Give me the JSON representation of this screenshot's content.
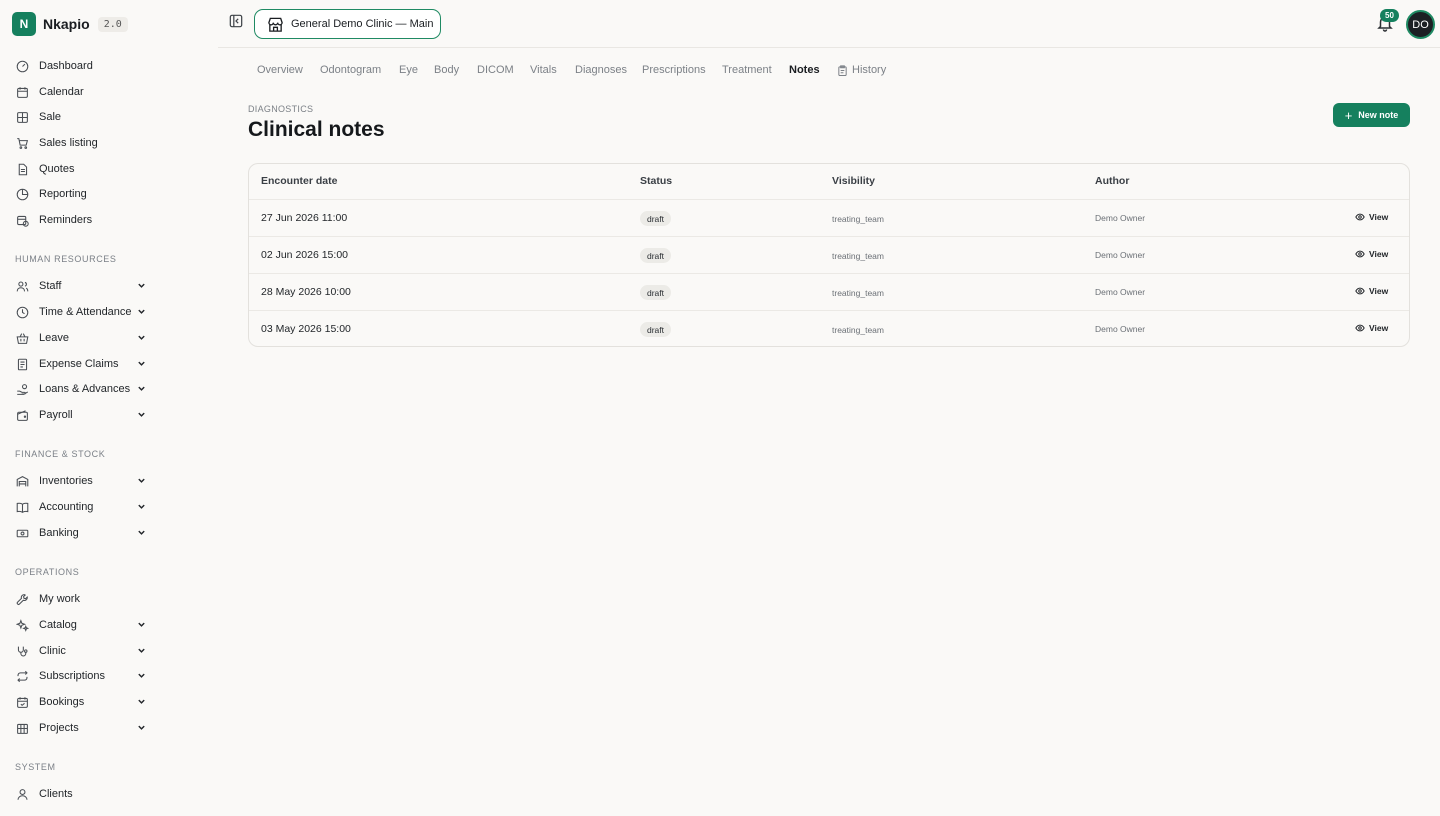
{
  "app": {
    "logo_letter": "N",
    "name": "Nkapio",
    "version": "2.0"
  },
  "sidebar": {
    "main_items": [
      {
        "label": "Dashboard",
        "icon": "gauge-icon"
      },
      {
        "label": "Calendar",
        "icon": "calendar-icon"
      },
      {
        "label": "Sale",
        "icon": "grid-icon"
      },
      {
        "label": "Sales listing",
        "icon": "cart-icon"
      },
      {
        "label": "Quotes",
        "icon": "document-icon"
      },
      {
        "label": "Reporting",
        "icon": "pie-chart-icon"
      },
      {
        "label": "Reminders",
        "icon": "calendar-clock-icon"
      }
    ],
    "sections": [
      {
        "label": "HUMAN RESOURCES",
        "items": [
          {
            "label": "Staff",
            "icon": "users-icon"
          },
          {
            "label": "Time & Attendance",
            "icon": "clock-icon"
          },
          {
            "label": "Leave",
            "icon": "basket-icon"
          },
          {
            "label": "Expense Claims",
            "icon": "receipt-icon"
          },
          {
            "label": "Loans & Advances",
            "icon": "hand-coins-icon"
          },
          {
            "label": "Payroll",
            "icon": "wallet-icon"
          }
        ]
      },
      {
        "label": "FINANCE & STOCK",
        "items": [
          {
            "label": "Inventories",
            "icon": "warehouse-icon"
          },
          {
            "label": "Accounting",
            "icon": "book-icon"
          },
          {
            "label": "Banking",
            "icon": "banknote-icon"
          }
        ]
      },
      {
        "label": "OPERATIONS",
        "items": [
          {
            "label": "My work",
            "icon": "wrench-icon"
          },
          {
            "label": "Catalog",
            "icon": "sparkles-icon"
          },
          {
            "label": "Clinic",
            "icon": "stethoscope-icon"
          },
          {
            "label": "Subscriptions",
            "icon": "repeat-icon"
          },
          {
            "label": "Bookings",
            "icon": "calendar-check-icon"
          },
          {
            "label": "Projects",
            "icon": "building-icon"
          }
        ]
      },
      {
        "label": "SYSTEM",
        "items": [
          {
            "label": "Clients",
            "icon": "user-icon"
          }
        ]
      }
    ]
  },
  "topbar": {
    "clinic_name": "General Demo Clinic — Main",
    "notifications": "50",
    "avatar_initials": "DO"
  },
  "tabs": [
    "Overview",
    "Odontogram",
    "Eye",
    "Body",
    "DICOM",
    "Vitals",
    "Diagnoses",
    "Prescriptions",
    "Treatment",
    "Notes",
    "History"
  ],
  "active_tab": "Notes",
  "page": {
    "eyebrow": "DIAGNOSTICS",
    "title": "Clinical notes",
    "new_button": "New note"
  },
  "table": {
    "headers": [
      "Encounter date",
      "Status",
      "Visibility",
      "Author"
    ],
    "rows": [
      {
        "date": "27 Jun 2026 11:00",
        "status": "draft",
        "visibility": "treating_team",
        "author": "Demo Owner",
        "action": "View"
      },
      {
        "date": "02 Jun 2026 15:00",
        "status": "draft",
        "visibility": "treating_team",
        "author": "Demo Owner",
        "action": "View"
      },
      {
        "date": "28 May 2026 10:00",
        "status": "draft",
        "visibility": "treating_team",
        "author": "Demo Owner",
        "action": "View"
      },
      {
        "date": "03 May 2026 15:00",
        "status": "draft",
        "visibility": "treating_team",
        "author": "Demo Owner",
        "action": "View"
      }
    ]
  },
  "colors": {
    "accent": "#15805e",
    "background": "#faf9f7"
  }
}
